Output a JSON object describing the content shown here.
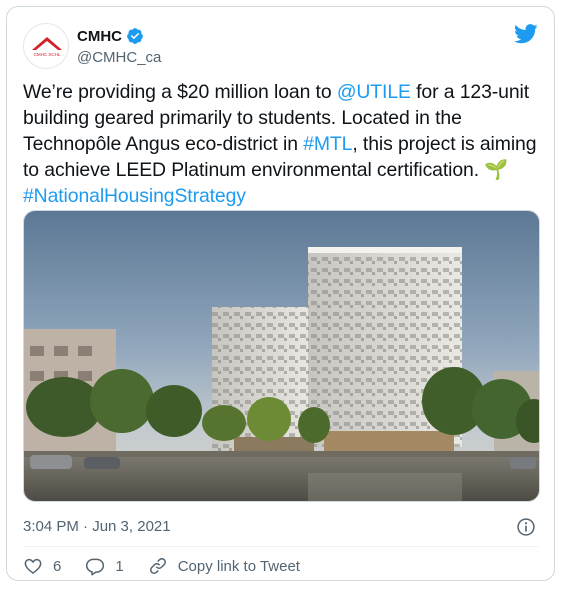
{
  "tweet": {
    "author_name": "CMHC",
    "handle": "@CMHC_ca",
    "avatar_text": "CMHC SCHL",
    "text_parts": {
      "p1": "We’re providing a $20 million loan to ",
      "mention": "@UTILE",
      "p2": " for a 123-unit building geared primarily to students. Located in the Technopôle Angus eco-district in ",
      "hashtag1": "#MTL",
      "p3": ", this project is aiming to achieve LEED Platinum environmental certification. ",
      "emoji": "🌱",
      "hashtag2": "#NationalHousingStrategy"
    },
    "timestamp": "3:04 PM · Jun 3, 2021",
    "likes": "6",
    "replies": "1",
    "copy_link_label": "Copy link to Tweet"
  },
  "colors": {
    "link": "#1d9bf0",
    "secondary_text": "#536471",
    "verified": "#1d9bf0",
    "brand_red": "#d2232a"
  },
  "icons": {
    "verified": "verified-badge-icon",
    "logo": "twitter-bird-icon",
    "info": "info-icon",
    "like": "heart-icon",
    "reply": "reply-bubble-icon",
    "copy": "link-icon"
  }
}
